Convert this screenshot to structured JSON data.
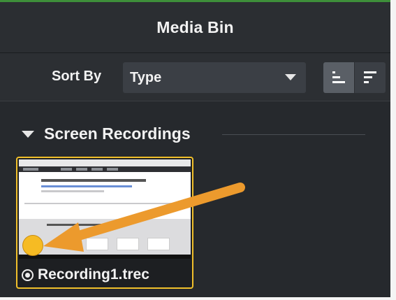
{
  "header": {
    "title": "Media Bin"
  },
  "sort": {
    "label": "Sort By",
    "selected": "Type",
    "view_modes": [
      "details-view-icon",
      "list-view-icon"
    ]
  },
  "section": {
    "title": "Screen Recordings"
  },
  "media": [
    {
      "name": "Recording1.trec",
      "type": "screen-recording",
      "selected": true
    }
  ],
  "colors": {
    "panel": "#26292d",
    "selection": "#f1c02b",
    "annotation_arrow": "#ec9a2d",
    "cursor_highlight": "#f6bb23"
  }
}
